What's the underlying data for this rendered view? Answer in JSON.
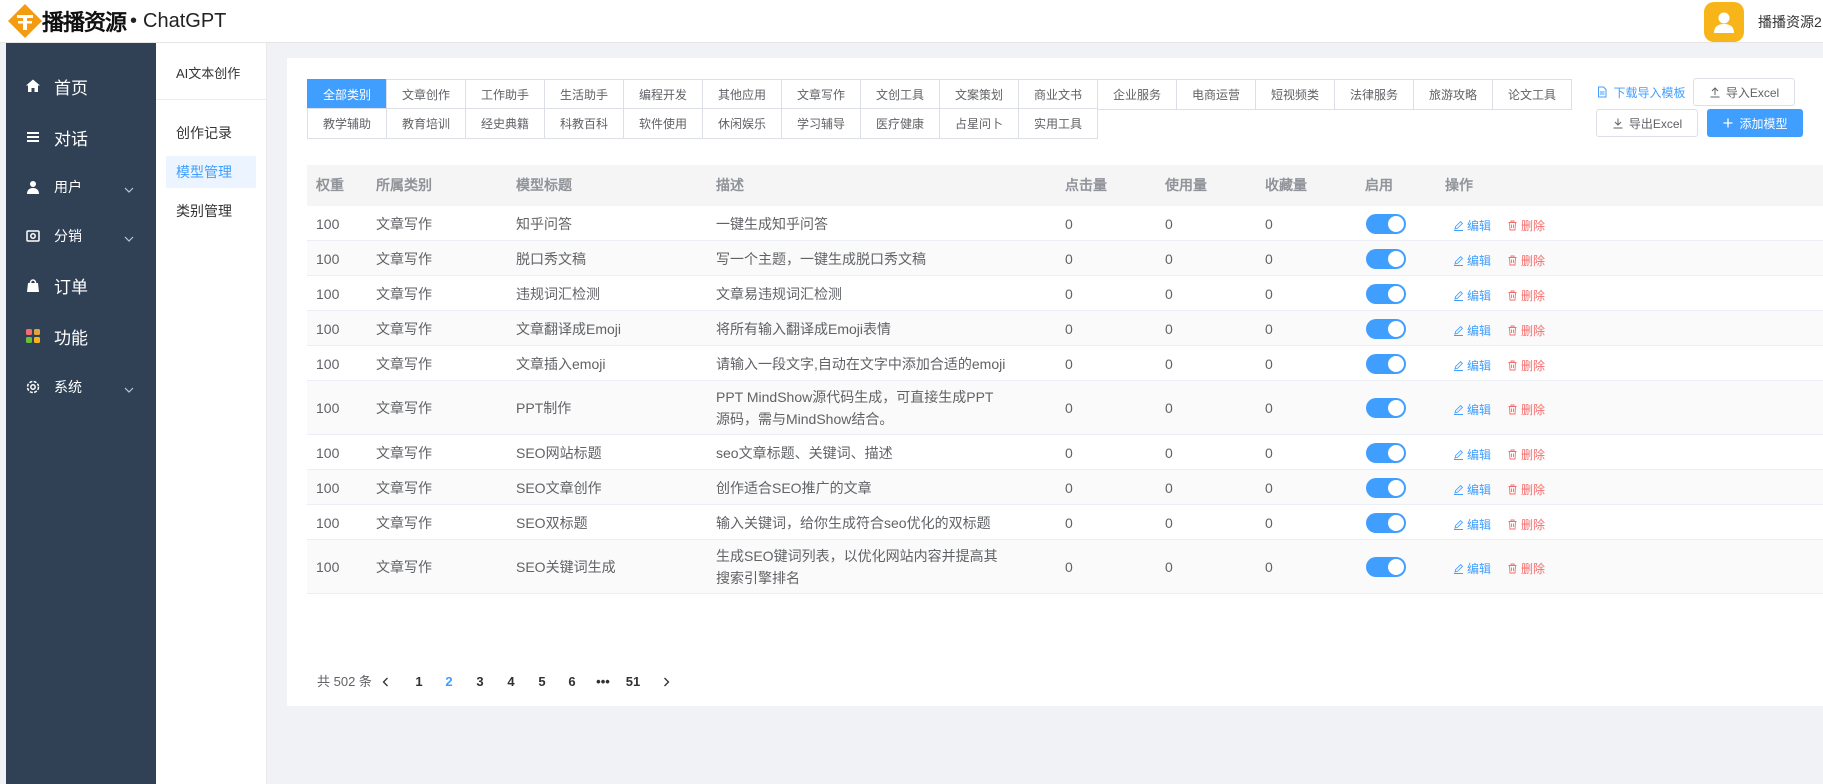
{
  "header": {
    "brand": "播播资源",
    "dot": "•",
    "product": "ChatGPT",
    "user_name": "播播资源2."
  },
  "sidebar": {
    "items": [
      {
        "label": "首页",
        "icon": "home-icon"
      },
      {
        "label": "对话",
        "icon": "menu-icon"
      },
      {
        "label": "用户",
        "icon": "user-icon"
      },
      {
        "label": "分销",
        "icon": "share-icon"
      },
      {
        "label": "订单",
        "icon": "bag-icon"
      },
      {
        "label": "功能",
        "icon": "grid-icon"
      },
      {
        "label": "系统",
        "icon": "gear-icon"
      }
    ]
  },
  "subnav": {
    "title": "AI文本创作",
    "items": [
      {
        "label": "创作记录"
      },
      {
        "label": "模型管理"
      },
      {
        "label": "类别管理"
      }
    ]
  },
  "categories": [
    "全部类别",
    "文章创作",
    "工作助手",
    "生活助手",
    "编程开发",
    "其他应用",
    "文章写作",
    "文创工具",
    "文案策划",
    "商业文书",
    "企业服务",
    "电商运营",
    "短视频类",
    "法律服务",
    "旅游攻略",
    "论文工具",
    "教学辅助",
    "教育培训",
    "经史典籍",
    "科教百科",
    "软件使用",
    "休闲娱乐",
    "学习辅导",
    "医疗健康",
    "占星问卜",
    "实用工具"
  ],
  "toolbar": {
    "download_template": "下载导入模板",
    "import_excel": "导入Excel",
    "export_excel": "导出Excel",
    "add_model": "添加模型"
  },
  "table": {
    "headers": [
      "权重",
      "所属类别",
      "模型标题",
      "描述",
      "点击量",
      "使用量",
      "收藏量",
      "启用",
      "操作"
    ],
    "edit_label": "编辑",
    "delete_label": "删除",
    "rows": [
      {
        "weight": "100",
        "category": "文章写作",
        "title": "知乎问答",
        "desc": "一键生成知乎问答",
        "clicks": "0",
        "uses": "0",
        "favs": "0",
        "enabled": true
      },
      {
        "weight": "100",
        "category": "文章写作",
        "title": "脱口秀文稿",
        "desc": "写一个主题，一键生成脱口秀文稿",
        "clicks": "0",
        "uses": "0",
        "favs": "0",
        "enabled": true
      },
      {
        "weight": "100",
        "category": "文章写作",
        "title": "违规词汇检测",
        "desc": "文章易违规词汇检测",
        "clicks": "0",
        "uses": "0",
        "favs": "0",
        "enabled": true
      },
      {
        "weight": "100",
        "category": "文章写作",
        "title": "文章翻译成Emoji",
        "desc": "将所有输入翻译成Emoji表情",
        "clicks": "0",
        "uses": "0",
        "favs": "0",
        "enabled": true
      },
      {
        "weight": "100",
        "category": "文章写作",
        "title": "文章插入emoji",
        "desc": "请输入一段文字,自动在文字中添加合适的emoji",
        "clicks": "0",
        "uses": "0",
        "favs": "0",
        "enabled": true
      },
      {
        "weight": "100",
        "category": "文章写作",
        "title": "PPT制作",
        "desc": "PPT MindShow源代码生成，可直接生成PPT源码，需与MindShow结合。",
        "clicks": "0",
        "uses": "0",
        "favs": "0",
        "enabled": true
      },
      {
        "weight": "100",
        "category": "文章写作",
        "title": "SEO网站标题",
        "desc": "seo文章标题、关键词、描述",
        "clicks": "0",
        "uses": "0",
        "favs": "0",
        "enabled": true
      },
      {
        "weight": "100",
        "category": "文章写作",
        "title": "SEO文章创作",
        "desc": "创作适合SEO推广的文章",
        "clicks": "0",
        "uses": "0",
        "favs": "0",
        "enabled": true
      },
      {
        "weight": "100",
        "category": "文章写作",
        "title": "SEO双标题",
        "desc": "输入关键词，给你生成符合seo优化的双标题",
        "clicks": "0",
        "uses": "0",
        "favs": "0",
        "enabled": true
      },
      {
        "weight": "100",
        "category": "文章写作",
        "title": "SEO关键词生成",
        "desc": "生成SEO键词列表，以优化网站内容并提高其搜索引擎排名",
        "clicks": "0",
        "uses": "0",
        "favs": "0",
        "enabled": true
      }
    ]
  },
  "pagination": {
    "total_text": "共 502 条",
    "pages": [
      "1",
      "2",
      "3",
      "4",
      "5",
      "6",
      "•••",
      "51"
    ],
    "current": "2"
  },
  "colors": {
    "primary": "#409eff",
    "danger": "#f56c6c",
    "sidebar_bg": "#304156",
    "avatar_bg": "#f7b51a"
  }
}
